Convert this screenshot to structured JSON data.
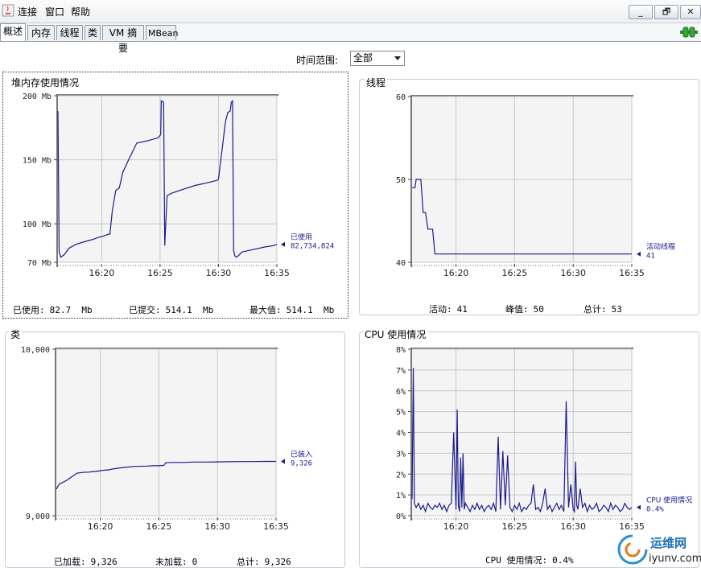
{
  "menubar": {
    "items": [
      "连接",
      "窗口",
      "帮助"
    ],
    "window_buttons": [
      "_",
      "🗗",
      "✕"
    ]
  },
  "tabs": [
    "概述",
    "内存",
    "线程",
    "类",
    "VM 摘要",
    "MBean"
  ],
  "time_range": {
    "label": "时间范围:",
    "value": "全部"
  },
  "panels": {
    "heap": {
      "title": "堆内存使用情况",
      "legend_label": "已使用",
      "legend_value": "82,734,824",
      "stats": [
        {
          "label": "已使用:",
          "value": "82.7  Mb"
        },
        {
          "label": "已提交:",
          "value": "514.1  Mb"
        },
        {
          "label": "最大值:",
          "value": "514.1  Mb"
        }
      ]
    },
    "threads": {
      "title": "线程",
      "legend_label": "活动线程",
      "legend_value": "41",
      "stats": [
        {
          "label": "活动:",
          "value": "41"
        },
        {
          "label": "峰值:",
          "value": "50"
        },
        {
          "label": "总计:",
          "value": "53"
        }
      ]
    },
    "classes": {
      "title": "类",
      "legend_label": "已装入",
      "legend_value": "9,326",
      "stats": [
        {
          "label": "已加载:",
          "value": "9,326"
        },
        {
          "label": "未加载:",
          "value": "0"
        },
        {
          "label": "总计:",
          "value": "9,326"
        }
      ]
    },
    "cpu": {
      "title": "CPU 使用情况",
      "legend_label": "CPU 使用情况",
      "legend_value": "0.4%",
      "stats": [
        {
          "label": "CPU 使用情况:",
          "value": "0.4%"
        }
      ]
    }
  },
  "watermark": {
    "text": "运维网",
    "subtext": "iyunv.com"
  },
  "colors": {
    "series": "#1a1a8c",
    "grid": "#c8c8c8",
    "plot_bg": "#f4f4f4"
  },
  "chart_data": [
    {
      "type": "line",
      "id": "heap",
      "title": "堆内存使用情况",
      "x_ticks": [
        "16:20",
        "16:25",
        "16:30",
        "16:35"
      ],
      "y_ticks": [
        "70 Mb",
        "100 Mb",
        "150 Mb",
        "200 Mb"
      ],
      "ylim": [
        70,
        200
      ],
      "xlim": [
        16.25,
        35
      ],
      "series": [
        {
          "name": "已使用",
          "x": [
            16.25,
            16.35,
            16.5,
            16.8,
            17.2,
            17.8,
            18.5,
            19.3,
            19.9,
            20.0,
            20.3,
            20.6,
            20.7,
            20.9,
            21.2,
            21.5,
            21.8,
            22.3,
            23.0,
            24.0,
            24.8,
            25.0,
            25.05,
            25.1,
            25.3,
            25.4,
            25.6,
            26.0,
            27.0,
            28.0,
            29.0,
            29.9,
            30.0,
            30.4,
            30.6,
            30.8,
            31.0,
            31.1,
            31.2,
            31.3,
            31.4,
            31.5,
            31.7,
            32.0,
            33.0,
            34.0,
            34.7,
            35.0
          ],
          "y": [
            188,
            78,
            74,
            76,
            81,
            84,
            86,
            88,
            90,
            90,
            91,
            92,
            92,
            110,
            126,
            128,
            140,
            150,
            163,
            165,
            167,
            169,
            170,
            196,
            195,
            83,
            122,
            124,
            127,
            130,
            132,
            134,
            135,
            165,
            180,
            187,
            188,
            195,
            196,
            79,
            75,
            74,
            75,
            78,
            80,
            82,
            83,
            84
          ]
        }
      ],
      "legend": "right"
    },
    {
      "type": "line",
      "id": "threads",
      "title": "线程",
      "x_ticks": [
        "16:20",
        "16:25",
        "16:30",
        "16:35"
      ],
      "y_ticks": [
        "40",
        "50",
        "60"
      ],
      "ylim": [
        40,
        60
      ],
      "xlim": [
        16.25,
        35
      ],
      "series": [
        {
          "name": "活动线程",
          "x": [
            16.25,
            16.5,
            16.6,
            17.0,
            17.2,
            17.4,
            17.6,
            18.0,
            18.2,
            18.4,
            35.0
          ],
          "y": [
            49,
            49,
            50,
            50,
            46,
            46,
            44,
            44,
            41,
            41,
            41
          ]
        }
      ],
      "legend": "right"
    },
    {
      "type": "line",
      "id": "classes",
      "title": "类",
      "x_ticks": [
        "16:20",
        "16:25",
        "16:30",
        "16:35"
      ],
      "y_ticks": [
        "9,000",
        "10,000"
      ],
      "ylim": [
        9000,
        10000
      ],
      "xlim": [
        16.25,
        35
      ],
      "series": [
        {
          "name": "已装入",
          "x": [
            16.25,
            16.5,
            16.8,
            17.2,
            17.4,
            17.8,
            18.0,
            18.5,
            19.0,
            19.5,
            20.0,
            20.3,
            20.8,
            21.0,
            21.5,
            22.0,
            23.0,
            24.0,
            24.5,
            25.0,
            25.4,
            25.6,
            26.0,
            27.0,
            28.0,
            29.0,
            30.0,
            31.0,
            32.0,
            33.0,
            34.0,
            35.0
          ],
          "y": [
            9160,
            9190,
            9200,
            9215,
            9225,
            9245,
            9255,
            9260,
            9262,
            9265,
            9270,
            9273,
            9276,
            9280,
            9285,
            9290,
            9296,
            9298,
            9300,
            9300,
            9302,
            9318,
            9320,
            9320,
            9322,
            9322,
            9323,
            9324,
            9325,
            9325,
            9326,
            9326
          ]
        }
      ],
      "legend": "right"
    },
    {
      "type": "line",
      "id": "cpu",
      "title": "CPU 使用情况",
      "x_ticks": [
        "16:20",
        "16:25",
        "16:30",
        "16:35"
      ],
      "y_ticks": [
        "0%",
        "1%",
        "2%",
        "3%",
        "4%",
        "5%",
        "6%",
        "7%",
        "8%"
      ],
      "ylim": [
        0,
        8
      ],
      "xlim": [
        16.25,
        35
      ],
      "series": [
        {
          "name": "CPU 使用情况",
          "x": [
            16.25,
            16.35,
            16.45,
            16.6,
            16.8,
            17.0,
            17.2,
            17.4,
            17.6,
            17.8,
            18.0,
            18.2,
            18.4,
            18.6,
            18.8,
            19.0,
            19.2,
            19.4,
            19.6,
            19.8,
            20.0,
            20.1,
            20.2,
            20.3,
            20.4,
            20.5,
            20.6,
            20.7,
            20.8,
            21.0,
            21.2,
            21.4,
            21.6,
            21.8,
            22.0,
            22.2,
            22.4,
            22.6,
            22.8,
            23.0,
            23.2,
            23.4,
            23.6,
            23.8,
            24.0,
            24.2,
            24.4,
            24.6,
            24.8,
            25.0,
            25.2,
            25.4,
            25.6,
            25.8,
            26.0,
            26.2,
            26.4,
            26.6,
            26.8,
            27.0,
            27.2,
            27.4,
            27.6,
            27.8,
            28.0,
            28.2,
            28.4,
            28.6,
            28.8,
            29.0,
            29.2,
            29.4,
            29.6,
            29.8,
            30.0,
            30.1,
            30.2,
            30.3,
            30.4,
            30.6,
            30.8,
            31.0,
            31.2,
            31.4,
            31.6,
            31.8,
            32.0,
            32.2,
            32.4,
            32.6,
            32.8,
            33.0,
            33.2,
            33.4,
            33.6,
            33.8,
            34.0,
            34.2,
            34.4,
            34.6,
            34.8,
            35.0
          ],
          "y": [
            0.8,
            7.1,
            0.6,
            0.4,
            0.6,
            0.3,
            0.5,
            0.2,
            0.6,
            0.4,
            0.3,
            0.5,
            0.4,
            0.6,
            0.3,
            0.5,
            0.2,
            0.5,
            0.6,
            4.0,
            0.3,
            5.1,
            0.5,
            0.2,
            2.8,
            0.4,
            3.0,
            0.3,
            0.6,
            0.4,
            0.2,
            0.5,
            0.3,
            0.6,
            0.3,
            0.5,
            0.2,
            0.4,
            0.5,
            0.3,
            0.6,
            0.2,
            3.8,
            0.3,
            3.1,
            0.5,
            2.9,
            0.4,
            0.2,
            0.5,
            0.3,
            0.6,
            0.2,
            0.4,
            0.3,
            0.5,
            0.6,
            1.5,
            0.3,
            0.4,
            0.2,
            0.6,
            1.3,
            0.3,
            0.5,
            0.2,
            0.4,
            0.6,
            0.3,
            0.5,
            0.2,
            5.5,
            0.4,
            1.5,
            0.3,
            0.2,
            2.6,
            0.5,
            0.3,
            1.3,
            0.4,
            0.6,
            0.2,
            0.5,
            0.3,
            0.4,
            0.6,
            0.2,
            0.3,
            0.5,
            0.4,
            0.2,
            0.6,
            0.3,
            0.5,
            0.4,
            0.2,
            0.3,
            0.6,
            0.4,
            0.3,
            0.4
          ]
        }
      ],
      "legend": "right"
    }
  ]
}
